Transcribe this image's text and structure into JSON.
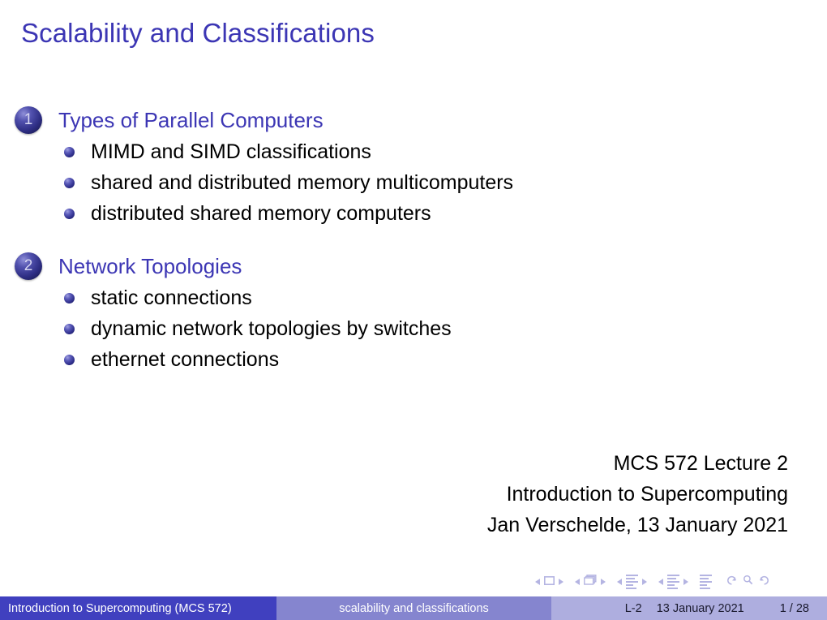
{
  "slide": {
    "title": "Scalability and Classifications",
    "sections": [
      {
        "number": "1",
        "title": "Types of Parallel Computers",
        "items": [
          "MIMD and SIMD classifications",
          "shared and distributed memory multicomputers",
          "distributed shared memory computers"
        ]
      },
      {
        "number": "2",
        "title": "Network Topologies",
        "items": [
          "static connections",
          "dynamic network topologies by switches",
          "ethernet connections"
        ]
      }
    ],
    "attribution": [
      "MCS 572 Lecture 2",
      "Introduction to Supercomputing",
      "Jan Verschelde, 13 January 2021"
    ]
  },
  "navigation": {
    "icons": [
      "previous-slide-icon",
      "slide-icon",
      "next-slide-icon",
      "previous-frame-icon",
      "frame-icon",
      "next-frame-icon",
      "previous-subsection-icon",
      "subsection-icon",
      "next-subsection-icon",
      "previous-section-icon",
      "section-icon",
      "next-section-icon",
      "document-icon",
      "back-icon",
      "find-icon",
      "forward-icon"
    ]
  },
  "footer": {
    "author": "Introduction to Supercomputing  (MCS 572)",
    "subtitle": "scalability and classifications",
    "lecture": "L-2",
    "date": "13 January 2021",
    "page": "1 / 28"
  },
  "colors": {
    "title_blue": "#3c36b4",
    "footer_left": "#4040bf",
    "footer_middle": "#8585cf",
    "footer_right": "#aeaedf",
    "nav_symbols": "#b4b4e2",
    "body_text": "#000000"
  }
}
